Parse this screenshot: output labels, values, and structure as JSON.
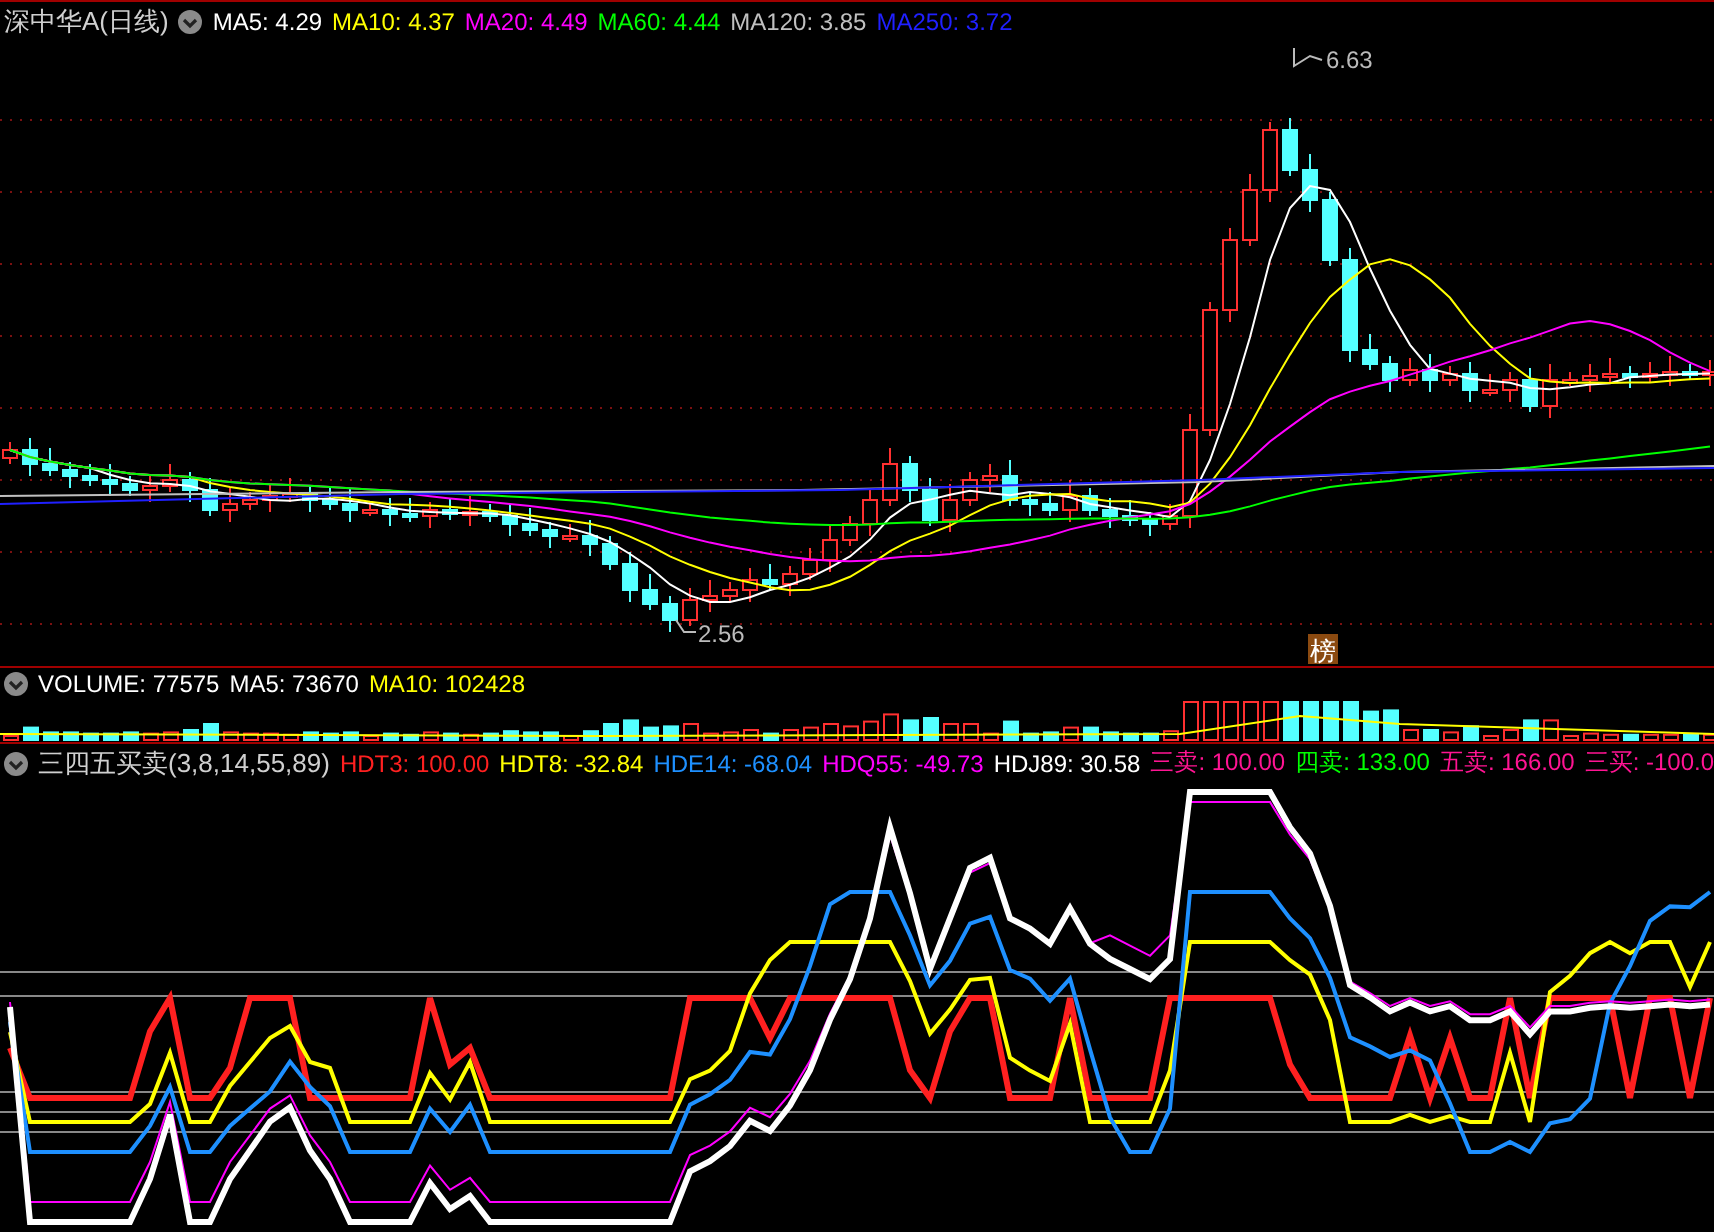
{
  "price_pane": {
    "title": "深中华A(日线)",
    "legend": [
      {
        "label": "MA5: 4.29",
        "color": "#ffffff"
      },
      {
        "label": "MA10: 4.37",
        "color": "#ffff00"
      },
      {
        "label": "MA20: 4.49",
        "color": "#ff00ff"
      },
      {
        "label": "MA60: 4.44",
        "color": "#00ff00"
      },
      {
        "label": "MA120: 3.85",
        "color": "#c0c0c0"
      },
      {
        "label": "MA250: 3.72",
        "color": "#2020ff"
      }
    ],
    "high_label": "6.63",
    "low_label": "2.56",
    "badge": "榜"
  },
  "volume_pane": {
    "legend": [
      {
        "label": "VOLUME: 77575",
        "color": "#ffffff"
      },
      {
        "label": "MA5: 73670",
        "color": "#ffffff"
      },
      {
        "label": "MA10: 102428",
        "color": "#ffff00"
      }
    ]
  },
  "indicator_pane": {
    "title": "三四五买卖(3,8,14,55,89)",
    "legend": [
      {
        "label": "HDT3: 100.00",
        "color": "#ff2020"
      },
      {
        "label": "HDT8: -32.84",
        "color": "#ffff00"
      },
      {
        "label": "HDE14: -68.04",
        "color": "#1e90ff"
      },
      {
        "label": "HDQ55: -49.73",
        "color": "#ff00ff"
      },
      {
        "label": "HDJ89: 30.58",
        "color": "#ffffff"
      },
      {
        "label": "三卖: 100.00",
        "color": "#ff1493"
      },
      {
        "label": "四卖: 133.00",
        "color": "#00ff00"
      },
      {
        "label": "五卖: 166.00",
        "color": "#ff1493"
      },
      {
        "label": "三买: -100.0",
        "color": "#ff1493"
      }
    ]
  }
}
